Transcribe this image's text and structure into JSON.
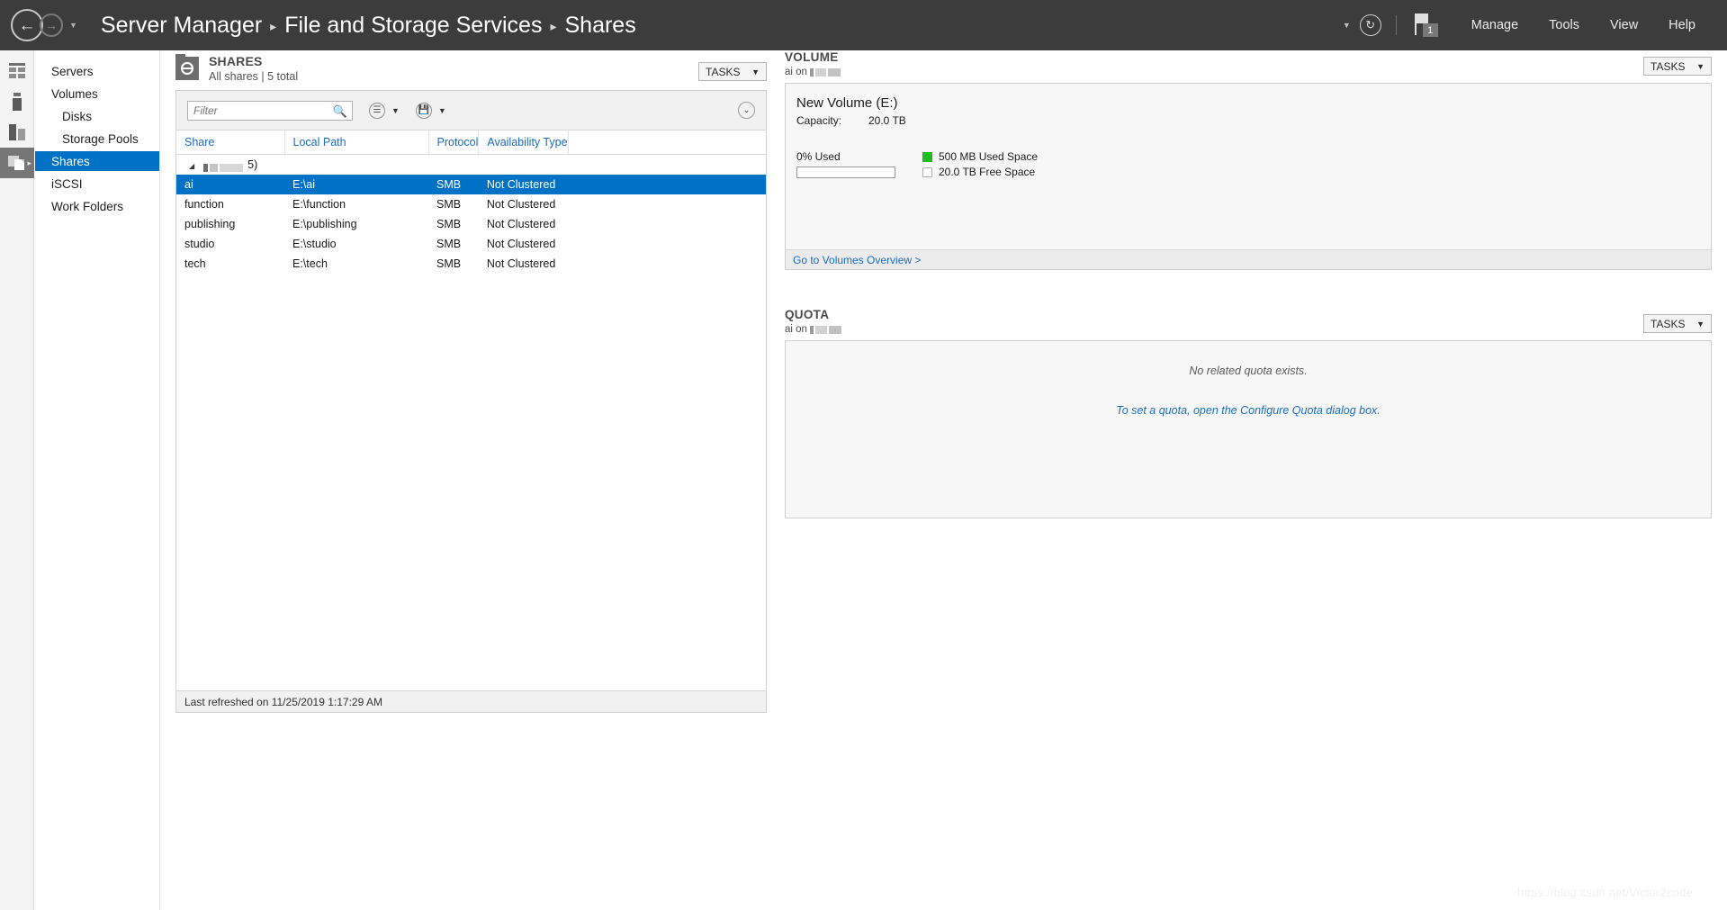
{
  "titlebar": {
    "back_icon": "arrow-left-icon",
    "forward_icon": "arrow-right-icon",
    "dropdown_caret": "▼",
    "breadcrumb": [
      "Server Manager",
      "File and Storage Services",
      "Shares"
    ],
    "separator": "▸",
    "notif_caret": "▼",
    "refresh_icon": "↻",
    "flag_badge_count": "1",
    "menu": [
      "Manage",
      "Tools",
      "View",
      "Help"
    ]
  },
  "rail": {
    "items": [
      {
        "name": "dashboard-icon"
      },
      {
        "name": "local-server-icon"
      },
      {
        "name": "all-servers-icon"
      },
      {
        "name": "file-and-storage-services-icon",
        "active": true,
        "arrow": "▸"
      }
    ]
  },
  "sidenav": {
    "items": [
      {
        "label": "Servers",
        "indent": false,
        "selected": false
      },
      {
        "label": "Volumes",
        "indent": false,
        "selected": false
      },
      {
        "label": "Disks",
        "indent": true,
        "selected": false
      },
      {
        "label": "Storage Pools",
        "indent": true,
        "selected": false
      },
      {
        "label": "Shares",
        "indent": false,
        "selected": true
      },
      {
        "label": "iSCSI",
        "indent": false,
        "selected": false
      },
      {
        "label": "Work Folders",
        "indent": false,
        "selected": false
      }
    ]
  },
  "shares": {
    "icon": "shares-folder-icon",
    "title": "SHARES",
    "subtitle": "All shares | 5 total",
    "tasks_label": "TASKS",
    "tasks_caret": "▼",
    "filter": {
      "value": "",
      "placeholder": "Filter",
      "search_icon": "search-icon"
    },
    "filter_btn_1_icon": "list-view-icon",
    "filter_btn_1_caret": "▼",
    "filter_btn_2_icon": "save-query-icon",
    "filter_btn_2_caret": "▼",
    "expander_icon": "⌄",
    "columns": [
      "Share",
      "Local Path",
      "Protocol",
      "Availability Type"
    ],
    "group_row": {
      "triangle": "◢",
      "label_redacted": true,
      "count_text": "5)"
    },
    "rows": [
      {
        "share": "ai",
        "path": "E:\\ai",
        "protocol": "SMB",
        "availability": "Not Clustered",
        "selected": true
      },
      {
        "share": "function",
        "path": "E:\\function",
        "protocol": "SMB",
        "availability": "Not Clustered",
        "selected": false
      },
      {
        "share": "publishing",
        "path": "E:\\publishing",
        "protocol": "SMB",
        "availability": "Not Clustered",
        "selected": false
      },
      {
        "share": "studio",
        "path": "E:\\studio",
        "protocol": "SMB",
        "availability": "Not Clustered",
        "selected": false
      },
      {
        "share": "tech",
        "path": "E:\\tech",
        "protocol": "SMB",
        "availability": "Not Clustered",
        "selected": false
      }
    ],
    "status": "Last refreshed on 11/25/2019 1:17:29 AM"
  },
  "volume": {
    "title": "VOLUME",
    "subtitle_prefix": "ai on",
    "tasks_label": "TASKS",
    "tasks_caret": "▼",
    "name": "New Volume (E:)",
    "capacity_label": "Capacity:",
    "capacity_value": "20.0 TB",
    "used_percent_label": "0% Used",
    "used_percent": 0,
    "legend": [
      {
        "swatch": "used",
        "text": "500 MB Used Space",
        "color": "#1fbd1f"
      },
      {
        "swatch": "free",
        "text": "20.0 TB Free Space",
        "color": "#ffffff"
      }
    ],
    "footer_link": "Go to Volumes Overview >"
  },
  "quota": {
    "title": "QUOTA",
    "subtitle_prefix": "ai on",
    "tasks_label": "TASKS",
    "tasks_caret": "▼",
    "empty_text": "No related quota exists.",
    "hint_text": "To set a quota, open the Configure Quota dialog box."
  },
  "watermark": "https://blog.csdn.net/Victor2code",
  "colors": {
    "accent": "#0072c6",
    "titlebar_bg": "#3c3c3c",
    "link": "#1b6ec2",
    "used_green": "#1fbd1f"
  }
}
